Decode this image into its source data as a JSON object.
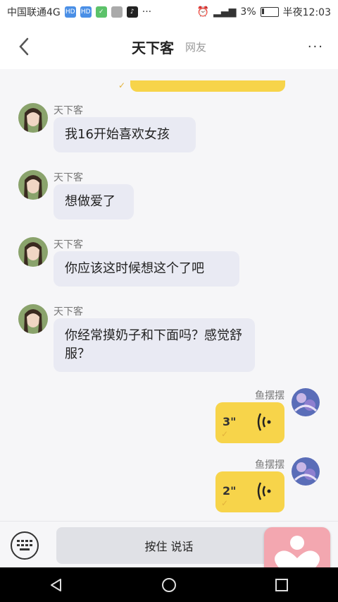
{
  "status": {
    "carrier": "中国联通4G",
    "battery": "3%",
    "time": "半夜12:03",
    "more": "···"
  },
  "header": {
    "title": "天下客",
    "subtitle": "网友",
    "more_label": "···"
  },
  "messages": [
    {
      "name": "天下客",
      "text": "我16开始喜欢女孩"
    },
    {
      "name": "天下客",
      "text": "想做爱了"
    },
    {
      "name": "天下客",
      "text": "你应该这时候想这个了吧"
    },
    {
      "name": "天下客",
      "text": "你经常摸奶子和下面吗？感觉舒服？"
    }
  ],
  "voice_messages": [
    {
      "name": "鱼摆摆",
      "duration": "3\""
    },
    {
      "name": "鱼摆摆",
      "duration": "2\""
    }
  ],
  "input": {
    "talk_label": "按住 说话"
  },
  "colors": {
    "accent_yellow": "#f7d44a",
    "bubble_other": "#e9eaf3",
    "float_pink": "#f3a7b0"
  }
}
